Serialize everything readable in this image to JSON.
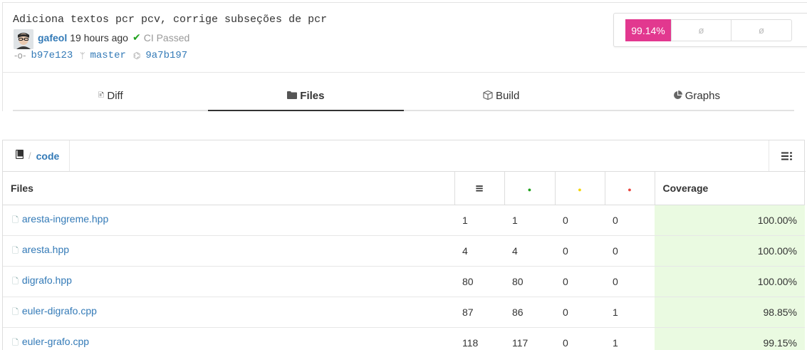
{
  "commit": {
    "message": "Adiciona textos pcr pcv, corrige subseções de pcr",
    "author": "gafeol",
    "time": "19 hours ago",
    "ci_icon": "✔",
    "ci_status": "CI Passed",
    "commit_icon": "-o-",
    "sha": "b97e123",
    "branch_icon": "ᛘ",
    "branch": "master",
    "parent_icon": "⌬",
    "parent_sha": "9a7b197"
  },
  "coverage_badge": {
    "value": "99.14%",
    "seg2": "ø",
    "seg3": "ø",
    "accent": "#e2388f"
  },
  "tabs": [
    {
      "label": "Diff",
      "icon": "file-diff-icon"
    },
    {
      "label": "Files",
      "icon": "folder-icon"
    },
    {
      "label": "Build",
      "icon": "package-icon"
    },
    {
      "label": "Graphs",
      "icon": "pie-chart-icon"
    }
  ],
  "breadcrumb": {
    "separator": "/",
    "current": "code"
  },
  "table": {
    "headers": {
      "files": "Files",
      "lines_icon": "≡",
      "hit_icon": "●",
      "partial_icon": "●",
      "miss_icon": "●",
      "coverage": "Coverage"
    },
    "colors": {
      "hit": "#21a21f",
      "partial": "#f5d60a",
      "miss": "#e9463f",
      "coverage_bg": "#eafae1"
    },
    "rows": [
      {
        "name": "aresta-ingreme.hpp",
        "lines": "1",
        "hits": "1",
        "partial": "0",
        "misses": "0",
        "coverage": "100.00%"
      },
      {
        "name": "aresta.hpp",
        "lines": "4",
        "hits": "4",
        "partial": "0",
        "misses": "0",
        "coverage": "100.00%"
      },
      {
        "name": "digrafo.hpp",
        "lines": "80",
        "hits": "80",
        "partial": "0",
        "misses": "0",
        "coverage": "100.00%"
      },
      {
        "name": "euler-digrafo.cpp",
        "lines": "87",
        "hits": "86",
        "partial": "0",
        "misses": "1",
        "coverage": "98.85%"
      },
      {
        "name": "euler-grafo.cpp",
        "lines": "118",
        "hits": "117",
        "partial": "0",
        "misses": "1",
        "coverage": "99.15%"
      }
    ]
  }
}
